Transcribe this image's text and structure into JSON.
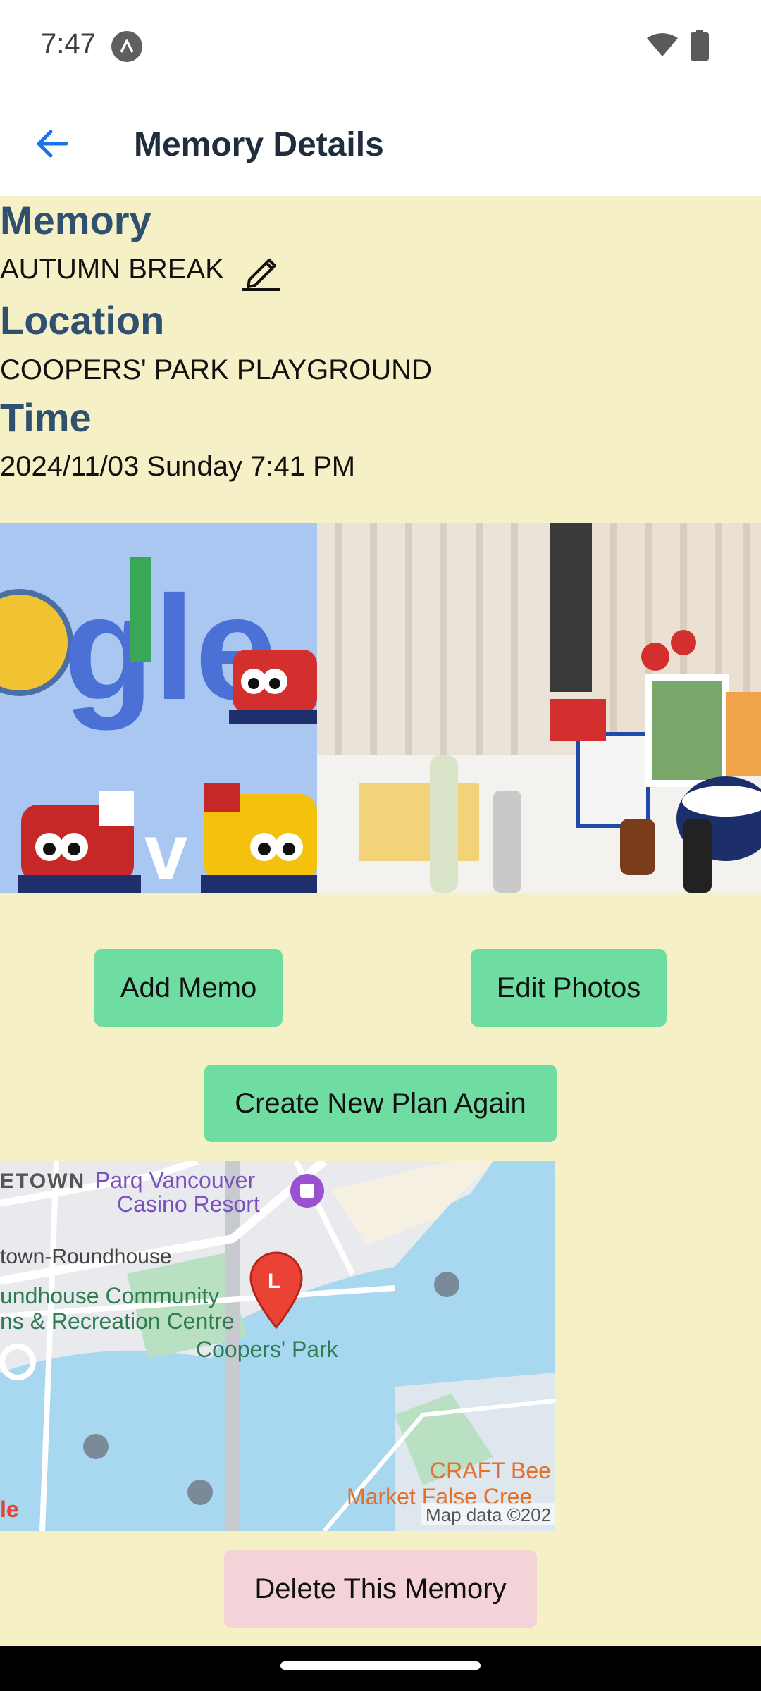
{
  "status": {
    "time": "7:47"
  },
  "appbar": {
    "title": "Memory Details"
  },
  "memory": {
    "label": "Memory",
    "value": "AUTUMN BREAK"
  },
  "location": {
    "label": "Location",
    "value": "COOPERS' PARK PLAYGROUND"
  },
  "time": {
    "label": "Time",
    "value": "2024/11/03 Sunday 7:41 PM"
  },
  "photos": {
    "photo1_text": "gle",
    "photo1_v": "v"
  },
  "buttons": {
    "add_memo": "Add Memo",
    "edit_photos": "Edit Photos",
    "create_plan": "Create New Plan Again",
    "delete": "Delete This Memory"
  },
  "map": {
    "labels": {
      "town": "ETOWN",
      "casino1": "Parq Vancouver",
      "casino2": "Casino Resort",
      "roundhouse": "town-Roundhouse",
      "community1": "undhouse Community",
      "community2": "ns & Recreation Centre",
      "park": "Coopers' Park",
      "craft": "CRAFT Bee",
      "market": "Market False Cree",
      "attribution": "Map data ©202",
      "google_fragment": "le",
      "pin_letter": "L"
    }
  },
  "colors": {
    "background": "#f6f0c6",
    "heading": "#30506f",
    "primary_button": "#6fdca1",
    "danger_button": "#f3d3d7",
    "accent": "#1a73e8"
  }
}
